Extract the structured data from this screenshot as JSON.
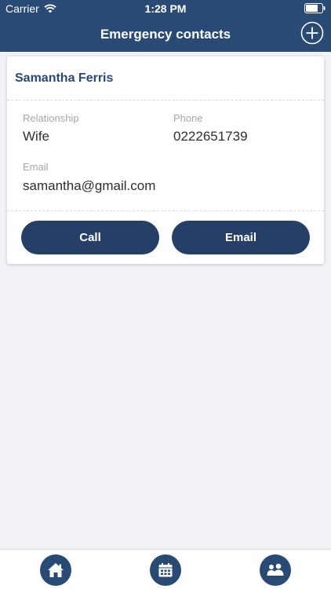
{
  "status_bar": {
    "carrier": "Carrier",
    "time": "1:28 PM",
    "icons": [
      "wifi-icon",
      "battery-icon"
    ]
  },
  "nav": {
    "title": "Emergency contacts",
    "add_icon": "plus-circle-icon"
  },
  "contact": {
    "name": "Samantha Ferris",
    "relationship_label": "Relationship",
    "relationship": "Wife",
    "phone_label": "Phone",
    "phone": "0222651739",
    "email_label": "Email",
    "email": "samantha@gmail.com",
    "call_label": "Call",
    "email_button_label": "Email"
  },
  "tab_bar": {
    "items": [
      {
        "icon": "home-icon"
      },
      {
        "icon": "calendar-icon"
      },
      {
        "icon": "people-icon"
      }
    ]
  },
  "colors": {
    "primary": "#2a4a76",
    "button": "#253f67",
    "background": "#f1f2f5",
    "label": "#a3a7ad"
  }
}
